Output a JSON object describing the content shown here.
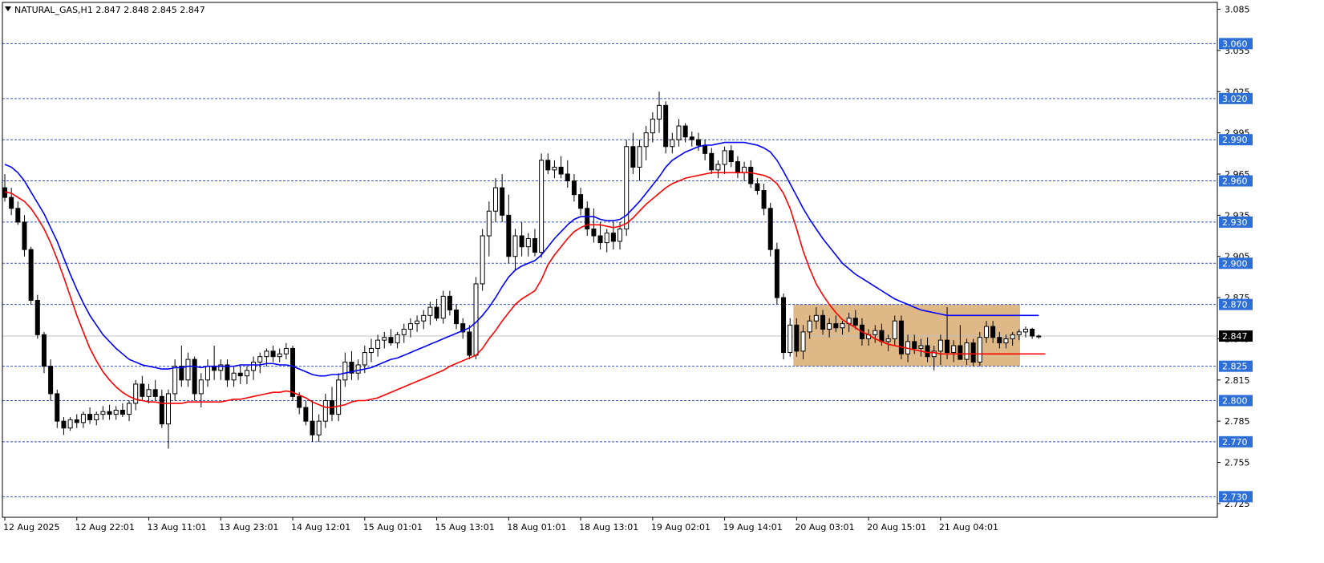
{
  "header": {
    "symbol_line": "NATURAL_GAS,H1  2.847 2.848 2.845 2.847"
  },
  "colors": {
    "level_line": "#3355cc",
    "level_tag_bg": "#2d6fd6",
    "ma_fast": "#ff0000",
    "ma_slow": "#0000ff",
    "zone_fill": "#deb887",
    "bid_tag_bg": "#000000"
  },
  "chart_data": {
    "type": "candlestick",
    "symbol": "NATURAL_GAS",
    "timeframe": "H1",
    "ohlc_header": {
      "open": 2.847,
      "high": 2.848,
      "low": 2.845,
      "close": 2.847
    },
    "last_price": "2.847",
    "y_range": [
      2.715,
      3.09
    ],
    "price_axis_ticks": [
      "3.085",
      "3.055",
      "3.025",
      "2.995",
      "2.965",
      "2.935",
      "2.905",
      "2.875",
      "2.845",
      "2.815",
      "2.785",
      "2.755",
      "2.725"
    ],
    "time_axis_labels": [
      "12 Aug 2025",
      "12 Aug 22:01",
      "13 Aug 11:01",
      "13 Aug 23:01",
      "14 Aug 12:01",
      "15 Aug 01:01",
      "15 Aug 13:01",
      "18 Aug 01:01",
      "18 Aug 13:01",
      "19 Aug 02:01",
      "19 Aug 14:01",
      "20 Aug 03:01",
      "20 Aug 15:01",
      "21 Aug 04:01"
    ],
    "horizontal_levels": [
      {
        "value": 3.06,
        "label": "3.060"
      },
      {
        "value": 3.02,
        "label": "3.020"
      },
      {
        "value": 2.99,
        "label": "2.990"
      },
      {
        "value": 2.96,
        "label": "2.960"
      },
      {
        "value": 2.93,
        "label": "2.930"
      },
      {
        "value": 2.9,
        "label": "2.900"
      },
      {
        "value": 2.87,
        "label": "2.870"
      },
      {
        "value": 2.825,
        "label": "2.825"
      },
      {
        "value": 2.8,
        "label": "2.800"
      },
      {
        "value": 2.77,
        "label": "2.770"
      },
      {
        "value": 2.73,
        "label": "2.730"
      }
    ],
    "consolidation_zone": {
      "from_label": "19 Aug 14:01",
      "price_low": 2.825,
      "price_high": 2.87
    },
    "candles": [
      [
        2.955,
        2.965,
        2.945,
        2.948
      ],
      [
        2.948,
        2.955,
        2.935,
        2.94
      ],
      [
        2.94,
        2.945,
        2.928,
        2.93
      ],
      [
        2.93,
        2.935,
        2.905,
        2.91
      ],
      [
        2.91,
        2.912,
        2.87,
        2.873
      ],
      [
        2.873,
        2.877,
        2.845,
        2.848
      ],
      [
        2.848,
        2.85,
        2.82,
        2.825
      ],
      [
        2.825,
        2.83,
        2.8,
        2.805
      ],
      [
        2.805,
        2.808,
        2.78,
        2.785
      ],
      [
        2.785,
        2.788,
        2.775,
        2.78
      ],
      [
        2.78,
        2.788,
        2.778,
        2.786
      ],
      [
        2.786,
        2.79,
        2.78,
        2.784
      ],
      [
        2.784,
        2.792,
        2.78,
        2.79
      ],
      [
        2.79,
        2.795,
        2.783,
        2.786
      ],
      [
        2.786,
        2.792,
        2.782,
        2.79
      ],
      [
        2.79,
        2.796,
        2.786,
        2.792
      ],
      [
        2.792,
        2.797,
        2.786,
        2.79
      ],
      [
        2.79,
        2.796,
        2.786,
        2.793
      ],
      [
        2.793,
        2.798,
        2.788,
        2.79
      ],
      [
        2.79,
        2.8,
        2.785,
        2.798
      ],
      [
        2.798,
        2.815,
        2.793,
        2.812
      ],
      [
        2.812,
        2.818,
        2.8,
        2.803
      ],
      [
        2.803,
        2.812,
        2.798,
        2.808
      ],
      [
        2.808,
        2.815,
        2.8,
        2.803
      ],
      [
        2.803,
        2.808,
        2.78,
        2.783
      ],
      [
        2.783,
        2.808,
        2.765,
        2.805
      ],
      [
        2.805,
        2.83,
        2.8,
        2.825
      ],
      [
        2.825,
        2.84,
        2.81,
        2.815
      ],
      [
        2.815,
        2.835,
        2.81,
        2.83
      ],
      [
        2.83,
        2.832,
        2.8,
        2.805
      ],
      [
        2.805,
        2.82,
        2.795,
        2.815
      ],
      [
        2.815,
        2.83,
        2.81,
        2.825
      ],
      [
        2.825,
        2.84,
        2.815,
        2.822
      ],
      [
        2.822,
        2.83,
        2.815,
        2.826
      ],
      [
        2.826,
        2.83,
        2.81,
        2.815
      ],
      [
        2.815,
        2.825,
        2.81,
        2.82
      ],
      [
        2.82,
        2.825,
        2.812,
        2.818
      ],
      [
        2.818,
        2.825,
        2.812,
        2.822
      ],
      [
        2.822,
        2.832,
        2.815,
        2.828
      ],
      [
        2.828,
        2.835,
        2.82,
        2.832
      ],
      [
        2.832,
        2.838,
        2.825,
        2.836
      ],
      [
        2.836,
        2.84,
        2.828,
        2.832
      ],
      [
        2.832,
        2.838,
        2.828,
        2.834
      ],
      [
        2.834,
        2.842,
        2.83,
        2.838
      ],
      [
        2.838,
        2.84,
        2.8,
        2.803
      ],
      [
        2.803,
        2.806,
        2.79,
        2.795
      ],
      [
        2.795,
        2.8,
        2.782,
        2.785
      ],
      [
        2.785,
        2.8,
        2.77,
        2.775
      ],
      [
        2.775,
        2.79,
        2.77,
        2.785
      ],
      [
        2.785,
        2.805,
        2.78,
        2.8
      ],
      [
        2.8,
        2.81,
        2.785,
        2.79
      ],
      [
        2.79,
        2.82,
        2.785,
        2.815
      ],
      [
        2.815,
        2.835,
        2.81,
        2.828
      ],
      [
        2.828,
        2.836,
        2.815,
        2.82
      ],
      [
        2.82,
        2.83,
        2.815,
        2.826
      ],
      [
        2.826,
        2.84,
        2.82,
        2.835
      ],
      [
        2.835,
        2.845,
        2.828,
        2.838
      ],
      [
        2.838,
        2.848,
        2.832,
        2.844
      ],
      [
        2.844,
        2.85,
        2.838,
        2.846
      ],
      [
        2.846,
        2.852,
        2.84,
        2.842
      ],
      [
        2.842,
        2.85,
        2.838,
        2.848
      ],
      [
        2.848,
        2.856,
        2.842,
        2.852
      ],
      [
        2.852,
        2.86,
        2.846,
        2.856
      ],
      [
        2.856,
        2.862,
        2.85,
        2.858
      ],
      [
        2.858,
        2.866,
        2.852,
        2.862
      ],
      [
        2.862,
        2.872,
        2.855,
        2.868
      ],
      [
        2.868,
        2.874,
        2.858,
        2.86
      ],
      [
        2.86,
        2.88,
        2.856,
        2.876
      ],
      [
        2.876,
        2.88,
        2.862,
        2.866
      ],
      [
        2.866,
        2.87,
        2.852,
        2.856
      ],
      [
        2.856,
        2.86,
        2.845,
        2.85
      ],
      [
        2.85,
        2.855,
        2.83,
        2.833
      ],
      [
        2.833,
        2.89,
        2.83,
        2.885
      ],
      [
        2.885,
        2.925,
        2.88,
        2.92
      ],
      [
        2.92,
        2.945,
        2.905,
        2.938
      ],
      [
        2.938,
        2.962,
        2.93,
        2.955
      ],
      [
        2.955,
        2.965,
        2.93,
        2.935
      ],
      [
        2.935,
        2.95,
        2.9,
        2.905
      ],
      [
        2.905,
        2.925,
        2.895,
        2.92
      ],
      [
        2.92,
        2.93,
        2.905,
        2.912
      ],
      [
        2.912,
        2.922,
        2.905,
        2.918
      ],
      [
        2.918,
        2.925,
        2.905,
        2.908
      ],
      [
        2.908,
        2.98,
        2.904,
        2.975
      ],
      [
        2.975,
        2.98,
        2.965,
        2.968
      ],
      [
        2.968,
        2.975,
        2.962,
        2.97
      ],
      [
        2.97,
        2.978,
        2.962,
        2.965
      ],
      [
        2.965,
        2.975,
        2.955,
        2.96
      ],
      [
        2.96,
        2.965,
        2.945,
        2.95
      ],
      [
        2.95,
        2.955,
        2.935,
        2.94
      ],
      [
        2.94,
        2.945,
        2.92,
        2.925
      ],
      [
        2.925,
        2.94,
        2.915,
        2.92
      ],
      [
        2.92,
        2.93,
        2.91,
        2.915
      ],
      [
        2.915,
        2.925,
        2.908,
        2.922
      ],
      [
        2.922,
        2.93,
        2.91,
        2.916
      ],
      [
        2.916,
        2.93,
        2.91,
        2.925
      ],
      [
        2.925,
        2.99,
        2.92,
        2.985
      ],
      [
        2.985,
        2.995,
        2.965,
        2.97
      ],
      [
        2.97,
        2.99,
        2.96,
        2.985
      ],
      [
        2.985,
        3.0,
        2.975,
        2.995
      ],
      [
        2.995,
        3.01,
        2.988,
        3.005
      ],
      [
        3.005,
        3.025,
        2.995,
        3.015
      ],
      [
        3.015,
        3.018,
        2.98,
        2.985
      ],
      [
        2.985,
        2.995,
        2.98,
        2.99
      ],
      [
        2.99,
        3.005,
        2.985,
        3.0
      ],
      [
        3.0,
        3.002,
        2.988,
        2.992
      ],
      [
        2.992,
        2.996,
        2.985,
        2.99
      ],
      [
        2.99,
        2.995,
        2.982,
        2.986
      ],
      [
        2.986,
        2.99,
        2.975,
        2.98
      ],
      [
        2.98,
        2.984,
        2.965,
        2.968
      ],
      [
        2.968,
        2.975,
        2.962,
        2.972
      ],
      [
        2.972,
        2.985,
        2.965,
        2.982
      ],
      [
        2.982,
        2.986,
        2.97,
        2.974
      ],
      [
        2.974,
        2.978,
        2.962,
        2.966
      ],
      [
        2.966,
        2.974,
        2.96,
        2.97
      ],
      [
        2.97,
        2.975,
        2.955,
        2.958
      ],
      [
        2.958,
        2.962,
        2.95,
        2.953
      ],
      [
        2.953,
        2.958,
        2.935,
        2.94
      ],
      [
        2.94,
        2.944,
        2.905,
        2.91
      ],
      [
        2.91,
        2.915,
        2.87,
        2.875
      ],
      [
        2.875,
        2.878,
        2.83,
        2.835
      ],
      [
        2.835,
        2.86,
        2.832,
        2.855
      ],
      [
        2.855,
        2.86,
        2.832,
        2.836
      ],
      [
        2.836,
        2.855,
        2.83,
        2.85
      ],
      [
        2.85,
        2.862,
        2.845,
        2.858
      ],
      [
        2.858,
        2.868,
        2.852,
        2.862
      ],
      [
        2.862,
        2.866,
        2.848,
        2.852
      ],
      [
        2.852,
        2.86,
        2.846,
        2.856
      ],
      [
        2.856,
        2.862,
        2.85,
        2.853
      ],
      [
        2.853,
        2.858,
        2.848,
        2.856
      ],
      [
        2.856,
        2.864,
        2.85,
        2.86
      ],
      [
        2.86,
        2.866,
        2.852,
        2.855
      ],
      [
        2.855,
        2.86,
        2.84,
        2.845
      ],
      [
        2.845,
        2.852,
        2.84,
        2.848
      ],
      [
        2.848,
        2.855,
        2.842,
        2.851
      ],
      [
        2.851,
        2.856,
        2.84,
        2.843
      ],
      [
        2.843,
        2.848,
        2.836,
        2.845
      ],
      [
        2.845,
        2.862,
        2.84,
        2.858
      ],
      [
        2.858,
        2.862,
        2.83,
        2.834
      ],
      [
        2.834,
        2.848,
        2.828,
        2.843
      ],
      [
        2.843,
        2.848,
        2.834,
        2.838
      ],
      [
        2.838,
        2.845,
        2.832,
        2.84
      ],
      [
        2.84,
        2.846,
        2.828,
        2.832
      ],
      [
        2.832,
        2.84,
        2.822,
        2.836
      ],
      [
        2.836,
        2.848,
        2.826,
        2.844
      ],
      [
        2.844,
        2.868,
        2.83,
        2.835
      ],
      [
        2.835,
        2.844,
        2.828,
        2.84
      ],
      [
        2.84,
        2.855,
        2.835,
        2.83
      ],
      [
        2.83,
        2.845,
        2.826,
        2.842
      ],
      [
        2.842,
        2.845,
        2.825,
        2.828
      ],
      [
        2.828,
        2.85,
        2.825,
        2.846
      ],
      [
        2.846,
        2.858,
        2.842,
        2.854
      ],
      [
        2.854,
        2.858,
        2.842,
        2.846
      ],
      [
        2.846,
        2.85,
        2.838,
        2.842
      ],
      [
        2.842,
        2.848,
        2.838,
        2.845
      ],
      [
        2.845,
        2.85,
        2.84,
        2.848
      ],
      [
        2.848,
        2.852,
        2.844,
        2.85
      ],
      [
        2.85,
        2.854,
        2.846,
        2.852
      ],
      [
        2.852,
        2.853,
        2.845,
        2.847
      ],
      [
        2.847,
        2.848,
        2.845,
        2.847
      ]
    ],
    "ma_slow": [
      2.972,
      2.97,
      2.966,
      2.96,
      2.952,
      2.944,
      2.936,
      2.926,
      2.916,
      2.904,
      2.892,
      2.881,
      2.871,
      2.862,
      2.855,
      2.848,
      2.843,
      2.838,
      2.834,
      2.83,
      2.828,
      2.826,
      2.825,
      2.824,
      2.823,
      2.823,
      2.824,
      2.824,
      2.825,
      2.825,
      2.824,
      2.825,
      2.825,
      2.825,
      2.825,
      2.825,
      2.826,
      2.826,
      2.826,
      2.826,
      2.827,
      2.827,
      2.826,
      2.826,
      2.825,
      2.823,
      2.821,
      2.819,
      2.818,
      2.818,
      2.819,
      2.819,
      2.82,
      2.821,
      2.822,
      2.823,
      2.824,
      2.826,
      2.828,
      2.83,
      2.831,
      2.833,
      2.835,
      2.837,
      2.839,
      2.841,
      2.843,
      2.845,
      2.847,
      2.849,
      2.851,
      2.853,
      2.857,
      2.862,
      2.868,
      2.875,
      2.883,
      2.89,
      2.895,
      2.898,
      2.9,
      2.902,
      2.906,
      2.912,
      2.918,
      2.923,
      2.928,
      2.932,
      2.934,
      2.934,
      2.934,
      2.932,
      2.931,
      2.931,
      2.932,
      2.935,
      2.94,
      2.945,
      2.951,
      2.957,
      2.963,
      2.97,
      2.975,
      2.978,
      2.981,
      2.983,
      2.985,
      2.986,
      2.986,
      2.987,
      2.988,
      2.988,
      2.988,
      2.988,
      2.987,
      2.986,
      2.984,
      2.981,
      2.975,
      2.967,
      2.958,
      2.949,
      2.94,
      2.932,
      2.925,
      2.918,
      2.912,
      2.906,
      2.9,
      2.896,
      2.892,
      2.889,
      2.886,
      2.883,
      2.88,
      2.877,
      2.874,
      2.872,
      2.87,
      2.868,
      2.866,
      2.865,
      2.864,
      2.863,
      2.862,
      2.862,
      2.862,
      2.862,
      2.862,
      2.862,
      2.862,
      2.862,
      2.862,
      2.862,
      2.862,
      2.862,
      2.862,
      2.862,
      2.862
    ],
    "ma_fast": [
      2.952,
      2.951,
      2.948,
      2.945,
      2.94,
      2.933,
      2.925,
      2.915,
      2.903,
      2.89,
      2.876,
      2.862,
      2.85,
      2.838,
      2.829,
      2.821,
      2.815,
      2.81,
      2.806,
      2.803,
      2.801,
      2.8,
      2.799,
      2.799,
      2.798,
      2.798,
      2.798,
      2.798,
      2.799,
      2.799,
      2.799,
      2.799,
      2.799,
      2.799,
      2.8,
      2.801,
      2.801,
      2.802,
      2.803,
      2.804,
      2.805,
      2.806,
      2.806,
      2.807,
      2.806,
      2.804,
      2.802,
      2.799,
      2.797,
      2.795,
      2.795,
      2.796,
      2.797,
      2.799,
      2.8,
      2.8,
      2.801,
      2.802,
      2.804,
      2.806,
      2.808,
      2.81,
      2.812,
      2.814,
      2.816,
      2.818,
      2.82,
      2.822,
      2.825,
      2.827,
      2.829,
      2.831,
      2.833,
      2.838,
      2.845,
      2.851,
      2.858,
      2.864,
      2.87,
      2.874,
      2.877,
      2.88,
      2.888,
      2.899,
      2.906,
      2.912,
      2.918,
      2.923,
      2.926,
      2.928,
      2.928,
      2.928,
      2.927,
      2.926,
      2.927,
      2.929,
      2.933,
      2.938,
      2.943,
      2.947,
      2.951,
      2.955,
      2.958,
      2.96,
      2.962,
      2.963,
      2.964,
      2.965,
      2.966,
      2.966,
      2.966,
      2.966,
      2.966,
      2.966,
      2.966,
      2.965,
      2.964,
      2.962,
      2.958,
      2.951,
      2.94,
      2.925,
      2.909,
      2.896,
      2.885,
      2.877,
      2.87,
      2.864,
      2.859,
      2.856,
      2.853,
      2.85,
      2.848,
      2.845,
      2.843,
      2.841,
      2.84,
      2.839,
      2.838,
      2.837,
      2.836,
      2.835,
      2.835,
      2.834,
      2.834,
      2.834,
      2.834,
      2.834,
      2.834,
      2.834,
      2.834,
      2.834,
      2.834,
      2.834,
      2.834,
      2.834,
      2.834,
      2.834,
      2.834,
      2.834
    ]
  }
}
